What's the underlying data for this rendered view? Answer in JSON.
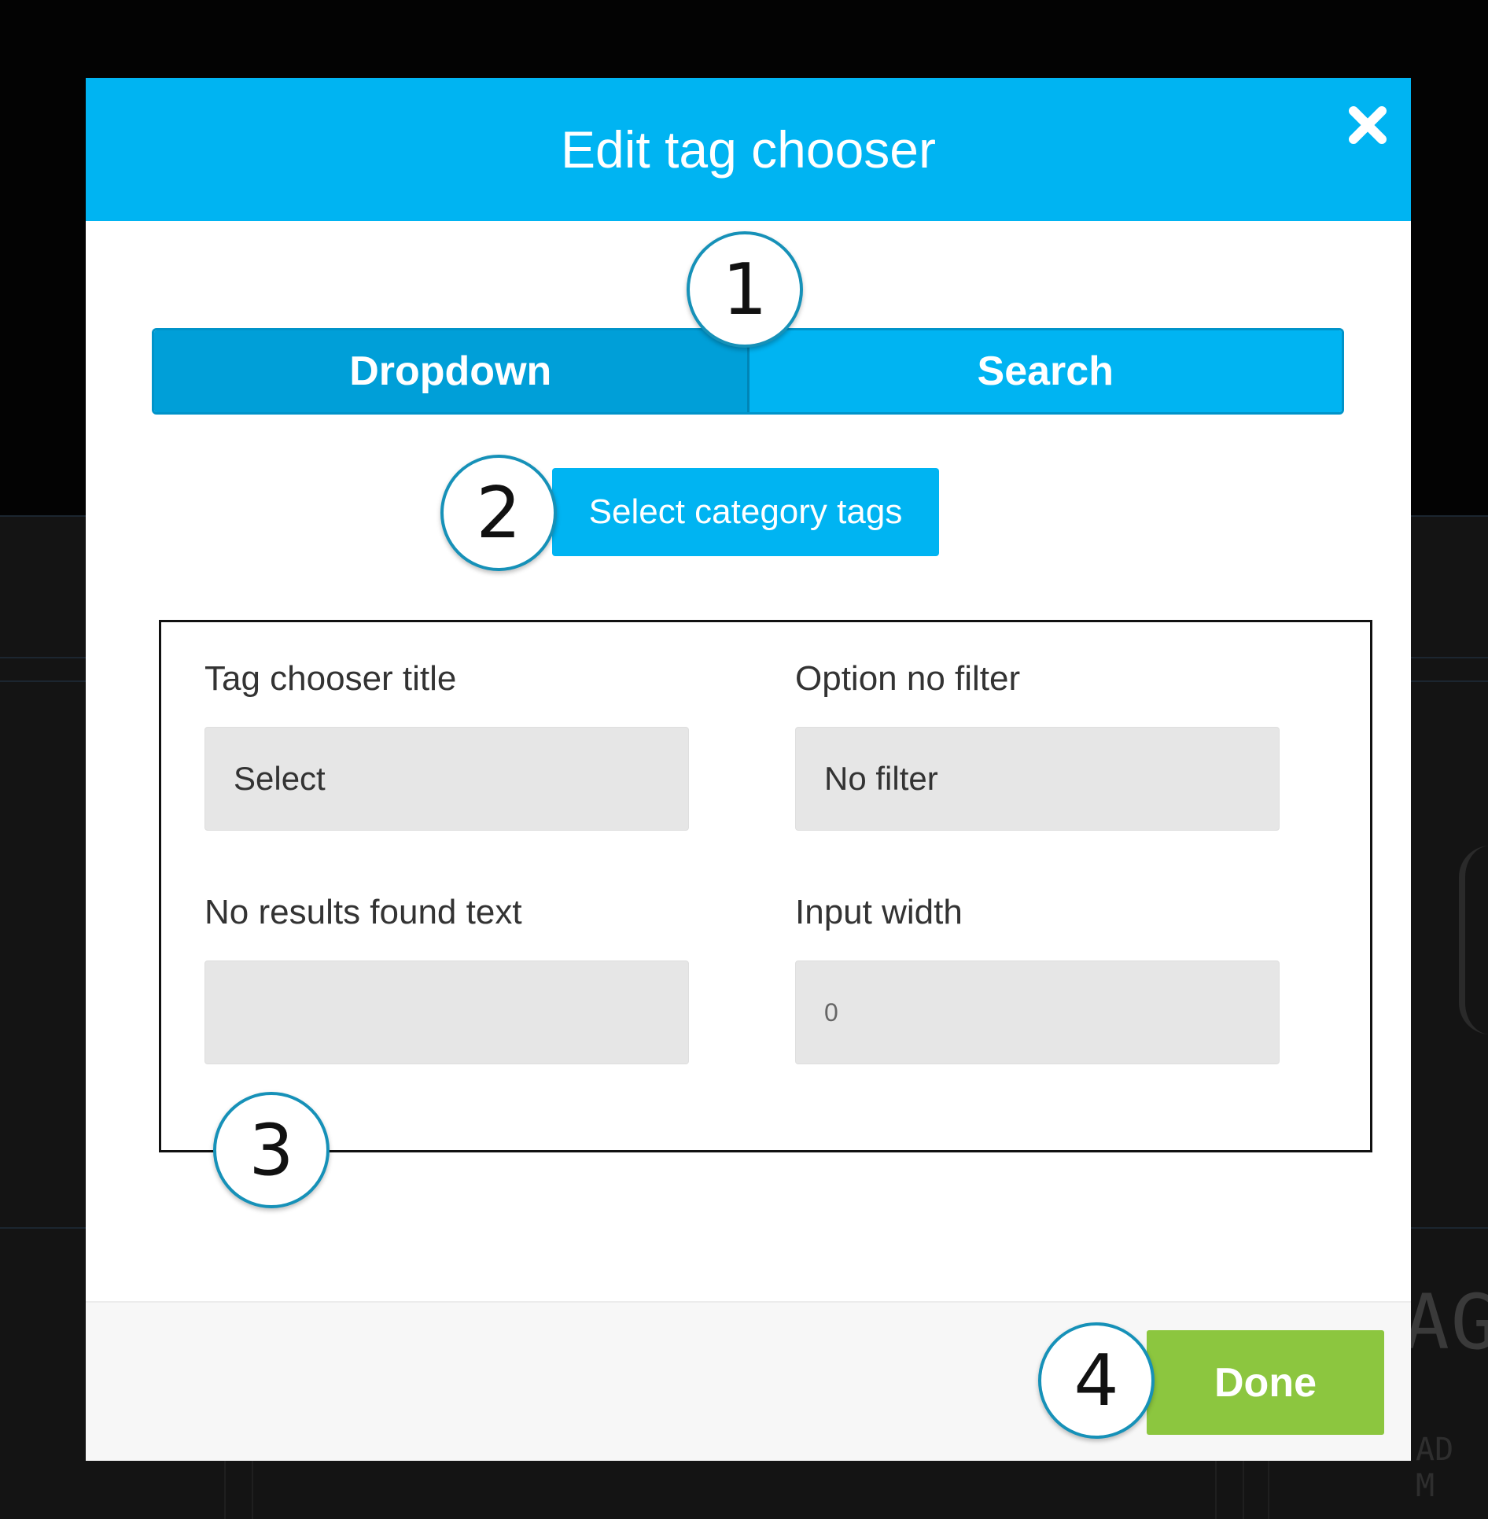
{
  "modal": {
    "title": "Edit tag chooser",
    "close_icon": "close-icon"
  },
  "tabs": [
    {
      "label": "Dropdown",
      "active": true
    },
    {
      "label": "Search",
      "active": false
    }
  ],
  "select_tags_button": "Select category tags",
  "fields": {
    "tag_chooser_title": {
      "label": "Tag chooser title",
      "value": "Select"
    },
    "option_no_filter": {
      "label": "Option no filter",
      "value": "No filter"
    },
    "no_results_text": {
      "label": "No results found text",
      "value": ""
    },
    "input_width": {
      "label": "Input width",
      "placeholder": "0"
    }
  },
  "footer": {
    "done_label": "Done"
  },
  "callouts": [
    "1",
    "2",
    "3",
    "4"
  ],
  "background": {
    "text_large": "AG",
    "text_small": "AD M"
  },
  "colors": {
    "header": "#00b4f2",
    "active_tab": "#009fd8",
    "done": "#8cc63f",
    "callout_border": "#1691b8"
  }
}
